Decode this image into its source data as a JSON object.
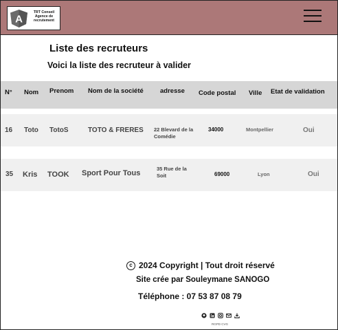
{
  "header": {
    "logo_letter": "A",
    "logo_text": [
      "TRT Conseil",
      "Agence de",
      "recrutement"
    ],
    "menu_icon": "hamburger-icon",
    "colors": {
      "header_bg": "#ac7878",
      "table_header_bg": "#d6d6d6",
      "row_bg": "#f0f0f0"
    }
  },
  "page": {
    "title": "Liste des recruteurs",
    "subtitle": "Voici la liste des recruteur à valider"
  },
  "table": {
    "headers": [
      "N°",
      "Nom",
      "Prenom",
      "Nom de la société",
      "adresse",
      "Code postal",
      "Ville",
      "Etat de validation"
    ],
    "rows": [
      [
        "16",
        "Toto",
        "TotoS",
        "TOTO & FRERES",
        "22 Blevard de la Comédie",
        "34000",
        "Montpellier",
        "Oui"
      ],
      [
        "35",
        "Kris",
        "TOOK",
        "Sport Pour Tous",
        "35 Rue de la Soit",
        "69000",
        "Lyon",
        "Oui"
      ]
    ]
  },
  "footer": {
    "copyright_symbol": "c",
    "copyright": "2024 Copyright | Tout droit réservé",
    "credit": "Site crée par Souleymane SANOGO",
    "phone": "Téléphone : 07 53 87 08 79",
    "social_icons": [
      "github-icon",
      "linkedin-icon",
      "instagram-icon",
      "mail-icon",
      "download-icon"
    ],
    "legal": "RGPD CVG"
  }
}
